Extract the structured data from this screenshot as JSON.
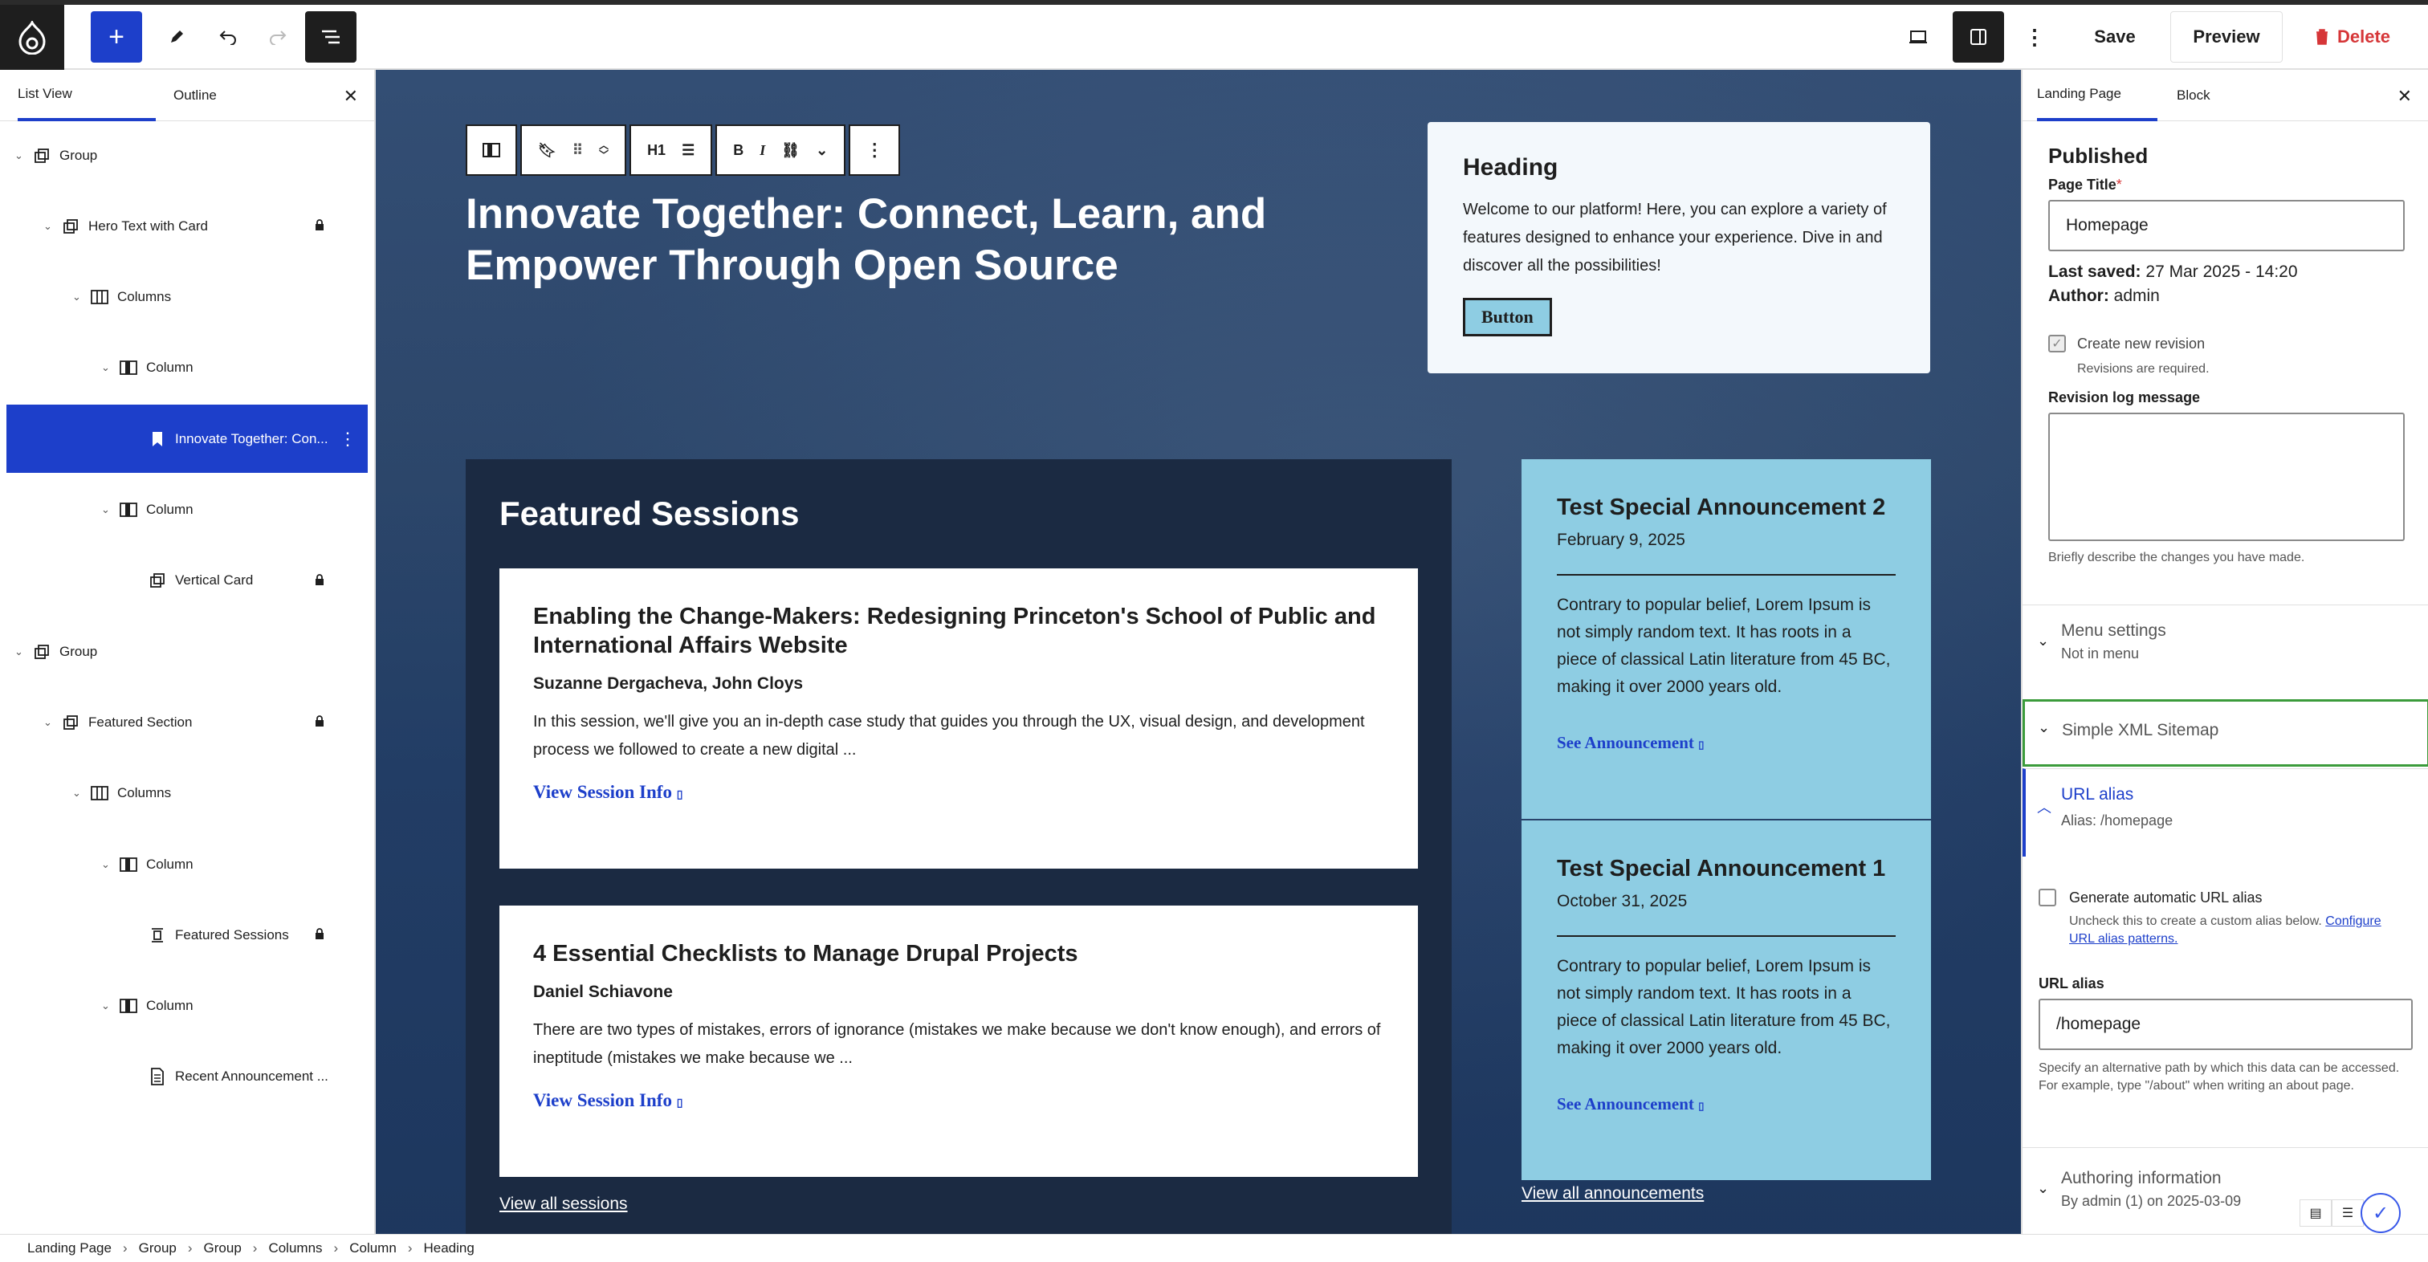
{
  "topbar": {
    "save_label": "Save",
    "preview_label": "Preview",
    "delete_label": "Delete"
  },
  "left_panel": {
    "tabs": [
      "List View",
      "Outline"
    ],
    "items": [
      {
        "label": "Group",
        "icon": "group-icon",
        "locked": false
      },
      {
        "label": "Hero Text with Card",
        "icon": "pattern-icon",
        "locked": true
      },
      {
        "label": "Columns",
        "icon": "columns-icon",
        "locked": false
      },
      {
        "label": "Column",
        "icon": "column-icon",
        "locked": false
      },
      {
        "label": "Innovate Together: Con...",
        "icon": "bookmark-icon",
        "locked": false,
        "selected": true
      },
      {
        "label": "Column",
        "icon": "column-icon",
        "locked": false
      },
      {
        "label": "Vertical Card",
        "icon": "pattern-icon",
        "locked": true
      },
      {
        "label": "Group",
        "icon": "group-icon",
        "locked": false
      },
      {
        "label": "Featured Section",
        "icon": "pattern-icon",
        "locked": true
      },
      {
        "label": "Columns",
        "icon": "columns-icon",
        "locked": false
      },
      {
        "label": "Column",
        "icon": "column-icon",
        "locked": false
      },
      {
        "label": "Featured Sessions",
        "icon": "query-icon",
        "locked": true
      },
      {
        "label": "Column",
        "icon": "column-icon",
        "locked": false
      },
      {
        "label": "Recent Announcement ...",
        "icon": "document-icon",
        "locked": false
      }
    ]
  },
  "canvas": {
    "heading_level": "H1",
    "hero_heading": "Innovate Together: Connect, Learn, and Empower Through Open Source",
    "card": {
      "title": "Heading",
      "text": "Welcome to our platform! Here, you can explore a variety of features designed to enhance your experience. Dive in and discover all the possibilities!",
      "button": "Button"
    },
    "featured": {
      "title": "Featured Sessions",
      "sessions": [
        {
          "title": "Enabling the Change-Makers: Redesigning Princeton's School of Public and International Affairs Website",
          "authors": "Suzanne Dergacheva, John Cloys",
          "excerpt": "In this session, we'll give you an in-depth case study that guides you through the UX, visual design, and development process we followed to create a new digital ...",
          "link": "View Session Info"
        },
        {
          "title": "4 Essential Checklists to Manage Drupal Projects",
          "authors": "Daniel Schiavone",
          "excerpt": "There are two types of mistakes, errors of ignorance (mistakes we make because we don't know enough), and errors of ineptitude (mistakes we make because we ...",
          "link": "View Session Info"
        }
      ],
      "view_all": "View all sessions"
    },
    "announcements": [
      {
        "title": "Test Special Announcement 2",
        "date": "February 9, 2025",
        "text": "Contrary to popular belief, Lorem Ipsum is not simply random text. It has roots in a piece of classical Latin literature from 45 BC, making it over 2000 years old.",
        "link": "See Announcement"
      },
      {
        "title": "Test Special Announcement 1",
        "date": "October 31, 2025",
        "text": "Contrary to popular belief, Lorem Ipsum is not simply random text. It has roots in a piece of classical Latin literature from 45 BC, making it over 2000 years old.",
        "link": "See Announcement"
      }
    ],
    "view_all_announcements": "View all announcements"
  },
  "right_panel": {
    "tabs": [
      "Landing Page",
      "Block"
    ],
    "status": "Published",
    "page_title_label": "Page Title",
    "required_mark": "*",
    "page_title_value": "Homepage",
    "last_saved_label": "Last saved:",
    "last_saved_value": "27 Mar 2025 - 14:20",
    "author_label": "Author:",
    "author_value": "admin",
    "create_revision_label": "Create new revision",
    "revisions_required": "Revisions are required.",
    "revision_log_label": "Revision log message",
    "revision_log_hint": "Briefly describe the changes you have made.",
    "menu_settings_label": "Menu settings",
    "menu_settings_sub": "Not in menu",
    "xml_sitemap_label": "Simple XML Sitemap",
    "url_alias_label": "URL alias",
    "url_alias_sub": "Alias: /homepage",
    "generate_alias_label": "Generate automatic URL alias",
    "generate_alias_hint_prefix": "Uncheck this to create a custom alias below.",
    "generate_alias_hint_link": "Configure URL alias patterns.",
    "url_alias_field_label": "URL alias",
    "url_alias_value": "/homepage",
    "url_alias_hint": "Specify an alternative path by which this data can be accessed. For example, type \"/about\" when writing an about page.",
    "authoring_label": "Authoring information",
    "authoring_sub": "By admin (1) on 2025-03-09"
  },
  "breadcrumbs": [
    "Landing Page",
    "Group",
    "Group",
    "Columns",
    "Column",
    "Heading"
  ],
  "colors": {
    "accent": "#1d3fca",
    "delete": "#d63638",
    "announcement_bg": "#8ecde3",
    "featured_bg": "#1b2a42"
  }
}
